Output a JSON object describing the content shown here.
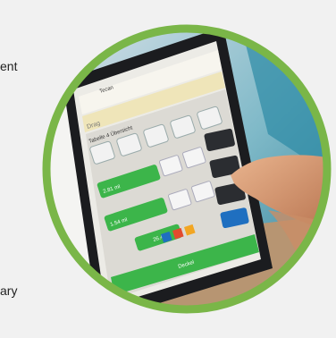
{
  "fragments": {
    "top": "ent",
    "bottom": "ary"
  },
  "screen": {
    "nav_label": "Tecan",
    "subtitle_prefix": "Drag",
    "status_title": "Tabelle 4 Übersicht",
    "field_values": [
      "2.81 ml",
      "1.54 ml",
      "26.4"
    ],
    "footer_label": "Deckel"
  },
  "colors": {
    "ring": "#7ab648",
    "screen_green": "#3cb54a",
    "accent_blue": "#1f6fc0"
  }
}
